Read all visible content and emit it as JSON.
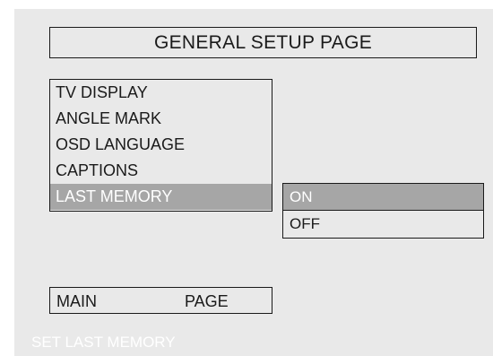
{
  "page": {
    "title": "GENERAL SETUP PAGE"
  },
  "menu": {
    "items": [
      {
        "label": "TV DISPLAY"
      },
      {
        "label": "ANGLE MARK"
      },
      {
        "label": "OSD LANGUAGE"
      },
      {
        "label": "CAPTIONS"
      },
      {
        "label": "LAST MEMORY",
        "selected": true
      }
    ]
  },
  "submenu": {
    "options": [
      {
        "label": "ON",
        "selected": true
      },
      {
        "label": "OFF"
      }
    ]
  },
  "footer": {
    "main_label": "MAIN",
    "page_label": "PAGE"
  },
  "status": {
    "text": "SET LAST MEMORY"
  },
  "colors": {
    "background": "#e9e9e9",
    "highlight": "#a6a6a6",
    "border": "#1a1a1a",
    "highlight_text": "#ffffff"
  }
}
